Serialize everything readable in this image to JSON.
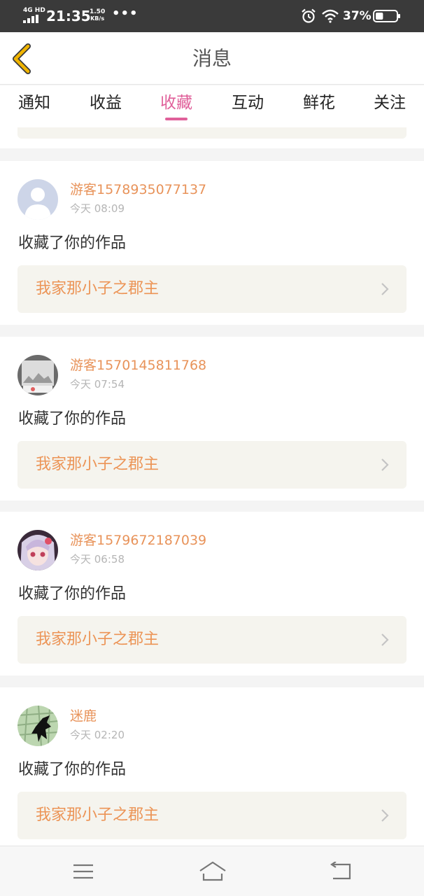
{
  "status_bar": {
    "network": "4G HD",
    "time": "21:35",
    "speed_value": "1.50",
    "speed_unit": "KB/s",
    "more": "•••",
    "battery_percent": "37%",
    "battery_level": 0.37
  },
  "header": {
    "title": "消息"
  },
  "tabs": [
    {
      "label": "通知",
      "active": false
    },
    {
      "label": "收益",
      "active": false
    },
    {
      "label": "收藏",
      "active": true
    },
    {
      "label": "互动",
      "active": false
    },
    {
      "label": "鲜花",
      "active": false
    },
    {
      "label": "关注",
      "active": false
    }
  ],
  "messages": [
    {
      "username": "游客1578935077137",
      "time": "今天 08:09",
      "action": "收藏了你的作品",
      "work_title": "我家那小子之郡主",
      "avatar": "default-avatar-icon"
    },
    {
      "username": "游客1570145811768",
      "time": "今天 07:54",
      "action": "收藏了你的作品",
      "work_title": "我家那小子之郡主",
      "avatar": "photo-avatar"
    },
    {
      "username": "游客1579672187039",
      "time": "今天 06:58",
      "action": "收藏了你的作品",
      "work_title": "我家那小子之郡主",
      "avatar": "anime-avatar"
    },
    {
      "username": "迷鹿",
      "time": "今天 02:20",
      "action": "收藏了你的作品",
      "work_title": "我家那小子之郡主",
      "avatar": "map-avatar"
    }
  ],
  "colors": {
    "accent": "#e0609a",
    "username": "#e8935a",
    "work_title": "#ec9456",
    "back_arrow": "#f0b400"
  },
  "navbar": {
    "icons": [
      "menu-icon",
      "home-icon",
      "back-icon"
    ]
  }
}
